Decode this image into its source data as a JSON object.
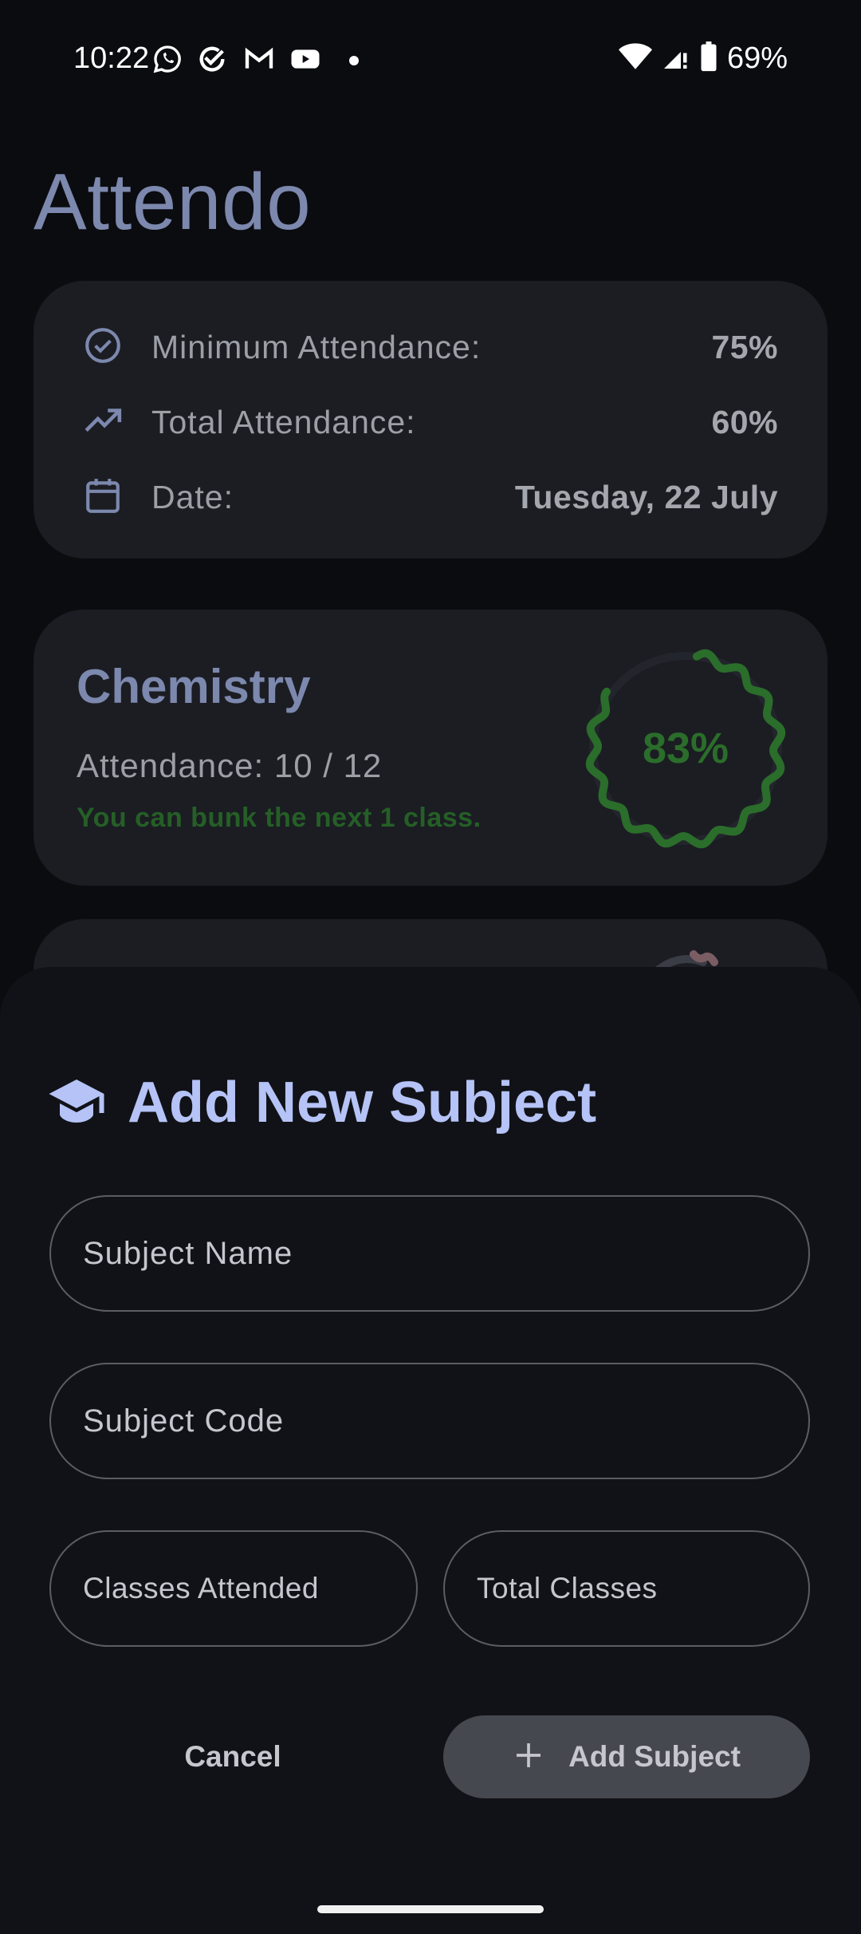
{
  "status_bar": {
    "time": "10:22",
    "battery_percent": "69%",
    "notification_icons": [
      "whatsapp-icon",
      "check-task-icon",
      "gmail-icon",
      "youtube-icon"
    ],
    "system_icons": [
      "wifi-icon",
      "cellular-signal-icon",
      "battery-icon"
    ]
  },
  "app": {
    "title": "Attendo"
  },
  "summary": {
    "min_label": "Minimum Attendance:",
    "min_value": "75%",
    "total_label": "Total Attendance:",
    "total_value": "60%",
    "date_label": "Date:",
    "date_value": "Tuesday, 22 July"
  },
  "subject": {
    "name": "Chemistry",
    "attendance_text": "Attendance: 10 / 12",
    "message": "You can bunk the next 1 class.",
    "percent_label": "83%",
    "percent_fraction": 0.83,
    "ring_color": "#2b6d2b"
  },
  "add_sheet": {
    "title": "Add New Subject",
    "icon": "graduation-cap-icon",
    "subject_name_placeholder": "Subject Name",
    "subject_code_placeholder": "Subject Code",
    "classes_attended_placeholder": "Classes Attended",
    "total_classes_placeholder": "Total Classes",
    "cancel_label": "Cancel",
    "add_label": "Add Subject"
  },
  "colors": {
    "background": "#0b0c10",
    "card": "#1b1d23",
    "accent": "#7c88ad",
    "sheet_title": "#b5c3f7",
    "success": "#2b6d2b"
  }
}
